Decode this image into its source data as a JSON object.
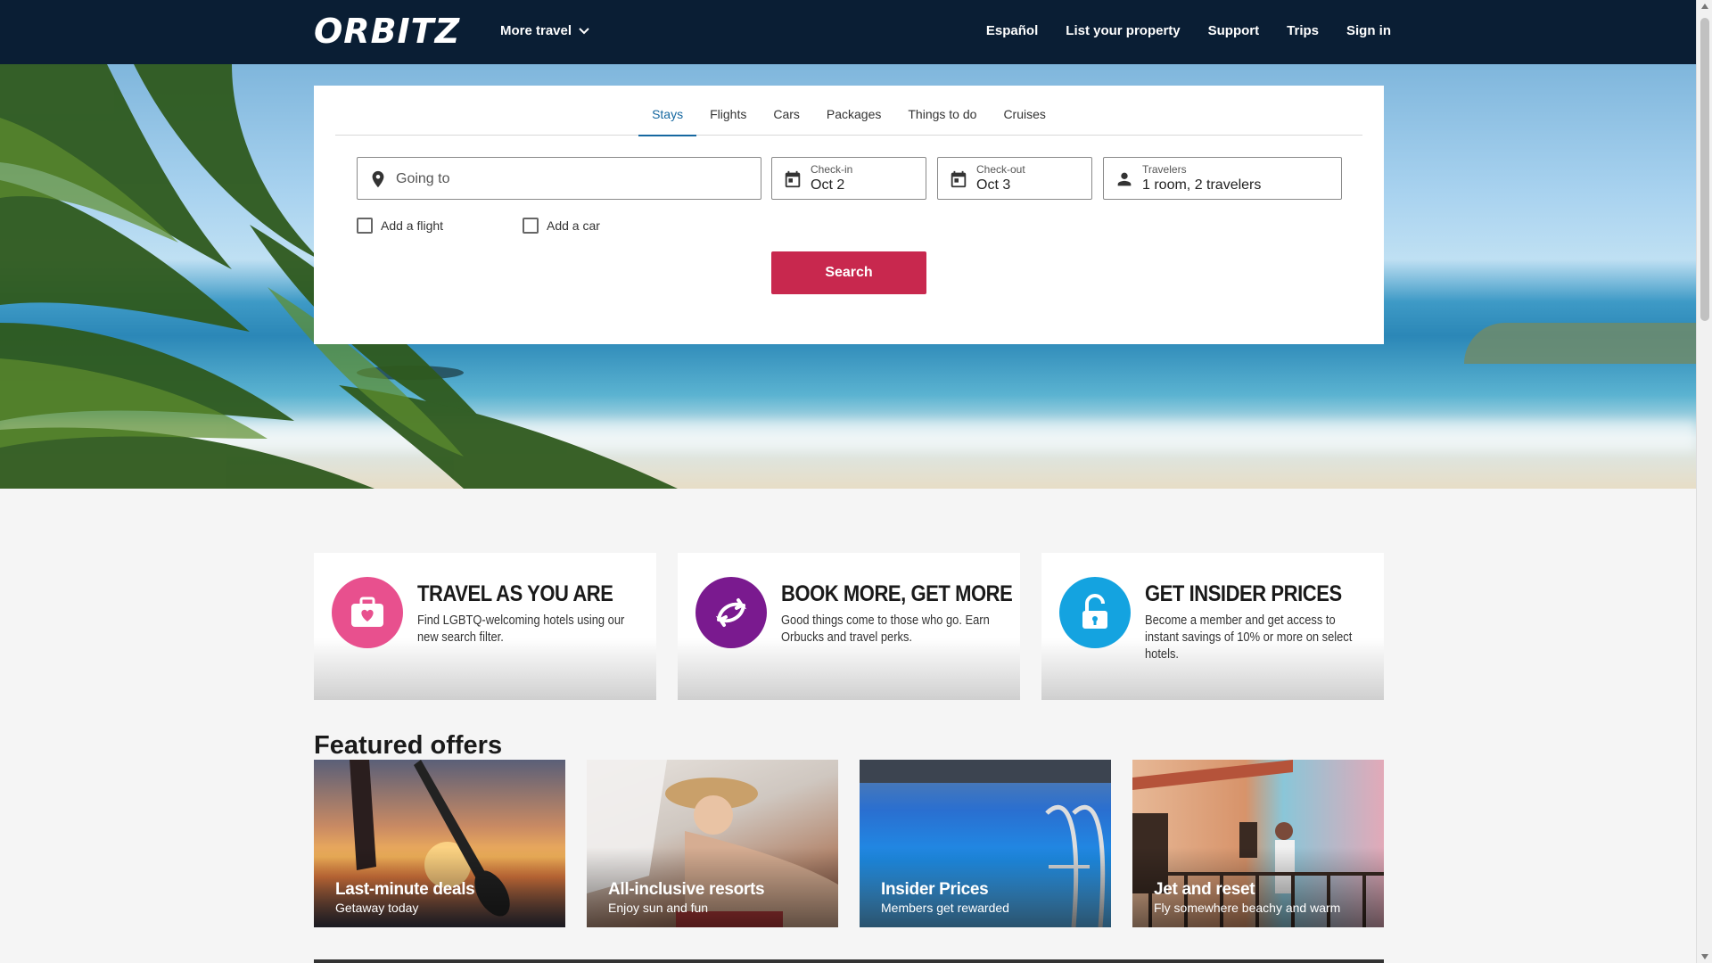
{
  "header": {
    "logo": "ORBITZ",
    "more_travel": "More travel",
    "nav": [
      "Español",
      "List your property",
      "Support",
      "Trips",
      "Sign in"
    ]
  },
  "search": {
    "tabs": [
      "Stays",
      "Flights",
      "Cars",
      "Packages",
      "Things to do",
      "Cruises"
    ],
    "active_tab": "Stays",
    "going_to_placeholder": "Going to",
    "checkin_label": "Check-in",
    "checkin_value": "Oct 2",
    "checkout_label": "Check-out",
    "checkout_value": "Oct 3",
    "travelers_label": "Travelers",
    "travelers_value": "1 room, 2 travelers",
    "add_flight": "Add a flight",
    "add_car": "Add a car",
    "search_button": "Search"
  },
  "promos": [
    {
      "title": "TRAVEL AS YOU ARE",
      "description": "Find LGBTQ-welcoming hotels using our new search filter.",
      "icon": "suitcase-heart-icon",
      "color": "#e8508e"
    },
    {
      "title": "BOOK MORE, GET MORE",
      "description": "Good things come to those who go. Earn Orbucks and travel perks.",
      "icon": "orbucks-icon",
      "color": "#7a1a8f"
    },
    {
      "title": "GET INSIDER PRICES",
      "description": "Become a member and get access to instant savings of 10% or more on select hotels.",
      "icon": "unlock-icon",
      "color": "#14a3e0"
    }
  ],
  "featured": {
    "title": "Featured offers",
    "offers": [
      {
        "title": "Last-minute deals",
        "subtitle": "Getaway today"
      },
      {
        "title": "All-inclusive resorts",
        "subtitle": "Enjoy sun and fun"
      },
      {
        "title": "Insider Prices",
        "subtitle": "Members get rewarded"
      },
      {
        "title": "Jet and reset",
        "subtitle": "Fly somewhere beachy and warm"
      }
    ]
  },
  "colors": {
    "header_bg": "#0a1e34",
    "accent": "#1668a0",
    "search_button": "#c8284e"
  }
}
